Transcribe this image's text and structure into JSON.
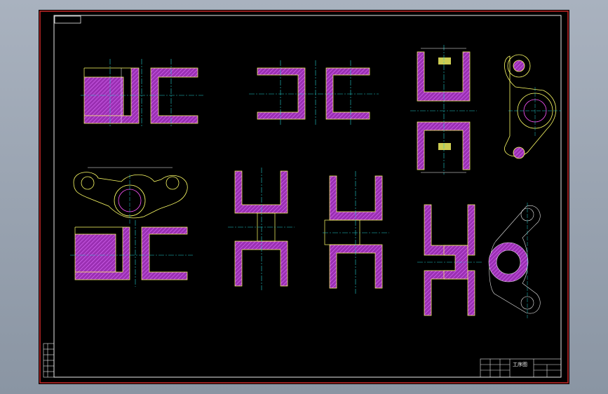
{
  "drawing": {
    "title_block_name": "工序图",
    "colors": {
      "sheet": "#000000",
      "outer_frame": "#c82828",
      "inner_frame": "#e8e8e8",
      "hatch": "#b040c8",
      "outline": "#ffff66",
      "centerline": "#22cccc",
      "dimension": "#ffffff"
    },
    "icons": [
      "hatched-section",
      "centerline",
      "dimension-line"
    ]
  }
}
